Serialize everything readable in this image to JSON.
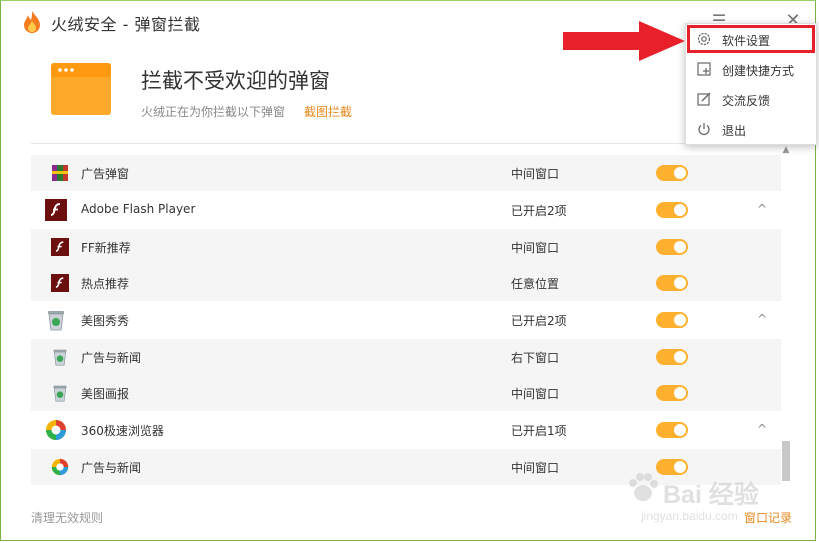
{
  "window": {
    "title": "火绒安全 - 弹窗拦截",
    "menu_icon": "hamburger-icon",
    "close_icon": "close-icon"
  },
  "header": {
    "title": "拦截不受欢迎的弹窗",
    "subtitle": "火绒正在为你拦截以下弹窗",
    "link": "截图拦截"
  },
  "rows": [
    {
      "type": "child",
      "icon": "winrar-icon",
      "name": "广告弹窗",
      "status": "中间窗口",
      "enabled": true
    },
    {
      "type": "parent",
      "icon": "flash-icon",
      "name": "Adobe Flash Player",
      "status": "已开启2项",
      "enabled": true,
      "collapse": "^"
    },
    {
      "type": "child",
      "icon": "flash-icon",
      "name": "FF新推荐",
      "status": "中间窗口",
      "enabled": true
    },
    {
      "type": "child",
      "icon": "flash-icon",
      "name": "热点推荐",
      "status": "任意位置",
      "enabled": true
    },
    {
      "type": "parent",
      "icon": "recycle-bin-icon",
      "name": "美图秀秀",
      "status": "已开启2项",
      "enabled": true,
      "collapse": "^"
    },
    {
      "type": "child",
      "icon": "recycle-bin-icon",
      "name": "广告与新闻",
      "status": "右下窗口",
      "enabled": true
    },
    {
      "type": "child",
      "icon": "recycle-bin-icon",
      "name": "美图画报",
      "status": "中间窗口",
      "enabled": true
    },
    {
      "type": "parent",
      "icon": "browser-360-icon",
      "name": "360极速浏览器",
      "status": "已开启1项",
      "enabled": true,
      "collapse": "^"
    },
    {
      "type": "child",
      "icon": "browser-360-icon",
      "name": "广告与新闻",
      "status": "中间窗口",
      "enabled": true
    }
  ],
  "menu": {
    "items": [
      {
        "icon": "gear-icon",
        "label": "软件设置"
      },
      {
        "icon": "shortcut-icon",
        "label": "创建快捷方式"
      },
      {
        "icon": "feedback-icon",
        "label": "交流反馈"
      },
      {
        "icon": "power-icon",
        "label": "退出"
      }
    ]
  },
  "footer": {
    "left": "清理无效规则",
    "right": "窗口记录"
  },
  "watermark": {
    "brand": "Bai 经验",
    "url": "jingyan.baidu.com"
  },
  "colors": {
    "accent": "#ffb02e",
    "link": "#e8891e",
    "highlight": "#e8202a",
    "border": "#7cb342"
  }
}
